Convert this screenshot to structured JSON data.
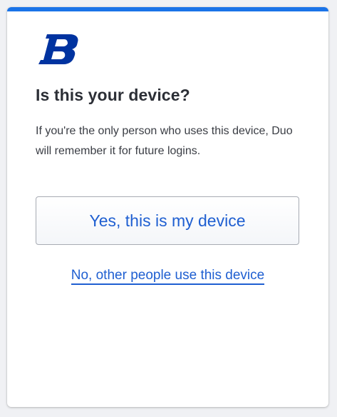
{
  "colors": {
    "accent": "#1a73e8",
    "link": "#1f5fd1",
    "brand": "#0033a0"
  },
  "logo": {
    "icon": "b-brand-logo-icon",
    "text": "B"
  },
  "prompt": {
    "title": "Is this your device?",
    "message": "If you're the only person who uses this device, Duo will remember it for future logins."
  },
  "actions": {
    "yes_label": "Yes, this is my device",
    "no_label": "No, other people use this device"
  }
}
